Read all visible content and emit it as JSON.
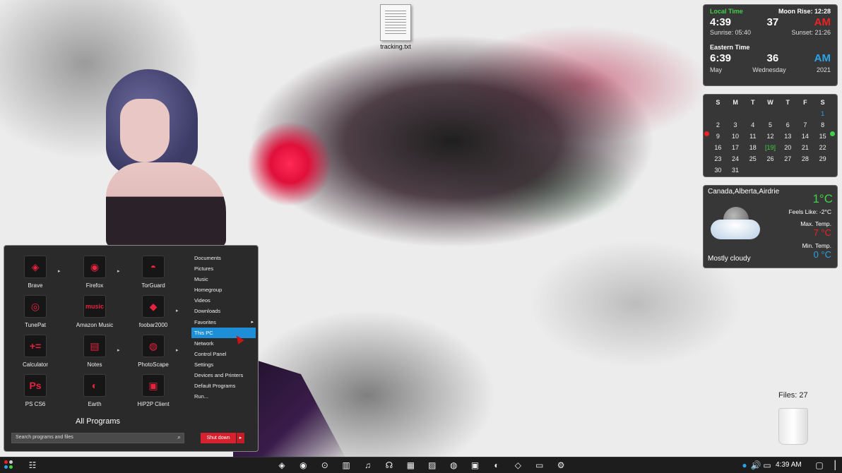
{
  "desktop": {
    "icons": [
      {
        "label": "tracking.txt"
      }
    ]
  },
  "clock_widget": {
    "local_label": "Local Time",
    "moon_rise_label": "Moon Rise: 12:28",
    "local_time": "4:39",
    "local_seconds": "37",
    "local_ampm": "AM",
    "sunrise": "Sunrise: 05:40",
    "sunset": "Sunset: 21:26",
    "eastern_label": "Eastern Time",
    "eastern_time": "6:39",
    "eastern_seconds": "36",
    "eastern_ampm": "AM",
    "month": "May",
    "weekday": "Wednesday",
    "year": "2021"
  },
  "calendar_widget": {
    "days": [
      "S",
      "M",
      "T",
      "W",
      "T",
      "F",
      "S"
    ],
    "rows": [
      [
        "",
        "",
        "",
        "",
        "",
        "",
        "1"
      ],
      [
        "2",
        "3",
        "4",
        "5",
        "6",
        "7",
        "8"
      ],
      [
        "9",
        "10",
        "11",
        "12",
        "13",
        "14",
        "15"
      ],
      [
        "16",
        "17",
        "18",
        "[19]",
        "20",
        "21",
        "22"
      ],
      [
        "23",
        "24",
        "25",
        "26",
        "27",
        "28",
        "29"
      ],
      [
        "30",
        "31",
        "",
        "",
        "",
        "",
        ""
      ]
    ],
    "colors": {
      "weekday_header": "#e22222",
      "today": "#3fd146",
      "saturday_first": "#2aa3e8"
    }
  },
  "weather_widget": {
    "location": "Canada,Alberta,Airdrie",
    "current_temp": "1°C",
    "feels_like": "Feels Like: -2°C",
    "max_label": "Max. Temp.",
    "max_temp": "7 °C",
    "min_label": "Min. Temp.",
    "min_temp": "0 °C",
    "condition": "Mostly cloudy",
    "icon": "cloud-moon-icon"
  },
  "files_widget": {
    "label": "Files: 27"
  },
  "start_menu": {
    "programs": [
      {
        "name": "Brave",
        "glyph": "◈"
      },
      {
        "name": "Firefox",
        "glyph": "◉"
      },
      {
        "name": "TorGuard",
        "glyph": "◓"
      },
      {
        "name": "TunePat",
        "glyph": "◎"
      },
      {
        "name": "Amazon Music",
        "glyph": "music"
      },
      {
        "name": "foobar2000",
        "glyph": "◆"
      },
      {
        "name": "Calculator",
        "glyph": "+="
      },
      {
        "name": "Notes",
        "glyph": "▤"
      },
      {
        "name": "PhotoScape",
        "glyph": "◍"
      },
      {
        "name": "PS CS6",
        "glyph": "Ps"
      },
      {
        "name": "Earth",
        "glyph": "◐"
      },
      {
        "name": "HiP2P Client",
        "glyph": "▣"
      }
    ],
    "all_programs": "All Programs",
    "search_placeholder": "Search programs and files",
    "shutdown_label": "Shut down",
    "places": [
      "Documents",
      "Pictures",
      "Music",
      "Homegroup",
      "Videos",
      "Downloads",
      "Favorites",
      "This PC",
      "Network",
      "Control Panel",
      "Settings",
      "Devices and Printers",
      "Default Programs",
      "Run..."
    ],
    "active_place": "This PC"
  },
  "taskbar": {
    "clock": "4:39 AM",
    "pinned": [
      "brave-icon",
      "firefox-icon",
      "media-icon",
      "equalizer-icon",
      "music-note-icon",
      "headphones-icon",
      "calculator-icon",
      "notes-icon",
      "photoscape-icon",
      "photoshop-icon",
      "earth-icon",
      "hip2p-icon",
      "monitor-icon",
      "settings-icon"
    ]
  }
}
